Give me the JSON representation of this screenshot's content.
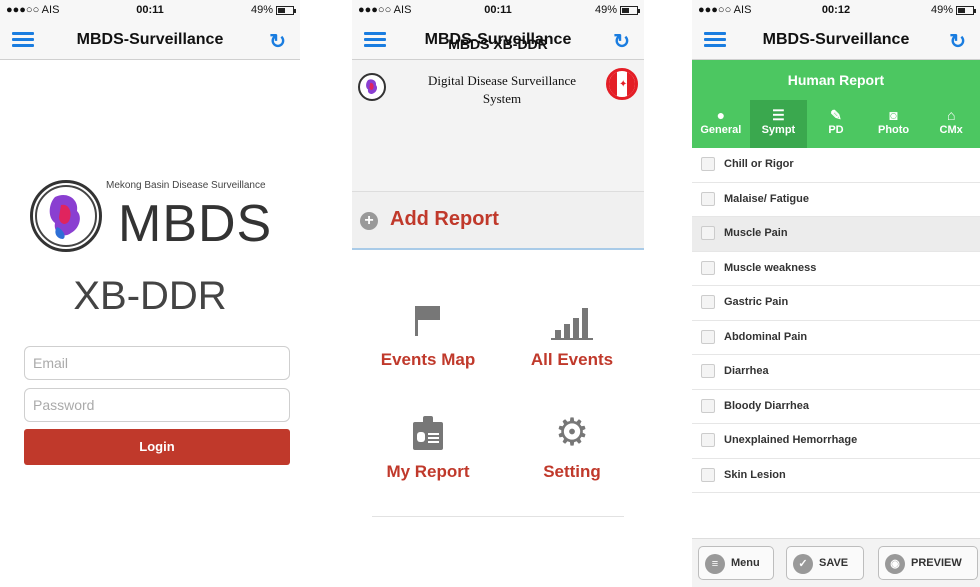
{
  "status": {
    "s1": {
      "carrier": "●●●○○ AIS ",
      "time": "00:11",
      "battery": "49%"
    },
    "s2": {
      "carrier": "●●●○○ AIS ",
      "time": "00:11",
      "battery": "49%"
    },
    "s3": {
      "carrier": "●●●○○ AIS ",
      "time": "00:12",
      "battery": "49%"
    }
  },
  "app_title": "MBDS-Surveillance",
  "login": {
    "brand_tag": "Mekong Basin Disease Surveillance",
    "brand": "MBDS",
    "subtitle": "XB-DDR",
    "email_placeholder": "Email",
    "password_placeholder": "Password",
    "login_label": "Login"
  },
  "home": {
    "header_title": "MBDS XB-DDR",
    "system_title": "Digital Disease Surveillance System",
    "add_report": "Add Report",
    "tiles": [
      {
        "label": "Events Map",
        "icon": "flag-icon"
      },
      {
        "label": "All Events",
        "icon": "bar-chart-icon"
      },
      {
        "label": "My Report",
        "icon": "id-card-icon"
      },
      {
        "label": "Setting",
        "icon": "gear-icon"
      }
    ]
  },
  "report": {
    "title": "Human Report",
    "tabs": [
      {
        "label": "General",
        "icon": "person-icon"
      },
      {
        "label": "Sympt",
        "icon": "list-icon"
      },
      {
        "label": "PD",
        "icon": "pencil-icon"
      },
      {
        "label": "Photo",
        "icon": "camera-icon"
      },
      {
        "label": "CMx",
        "icon": "home-icon"
      }
    ],
    "symptoms": [
      "Chill or Rigor",
      "Malaise/ Fatigue",
      "Muscle Pain",
      "Muscle weakness",
      "Gastric Pain",
      "Abdominal Pain",
      "Diarrhea",
      "Bloody Diarrhea",
      "Unexplained Hemorrhage",
      "Skin Lesion"
    ],
    "footer": {
      "menu": "Menu",
      "save": "SAVE",
      "preview": "PREVIEW"
    }
  },
  "colors": {
    "accent_blue": "#1a7de0",
    "brand_red": "#c0392b",
    "green": "#4cc761"
  }
}
